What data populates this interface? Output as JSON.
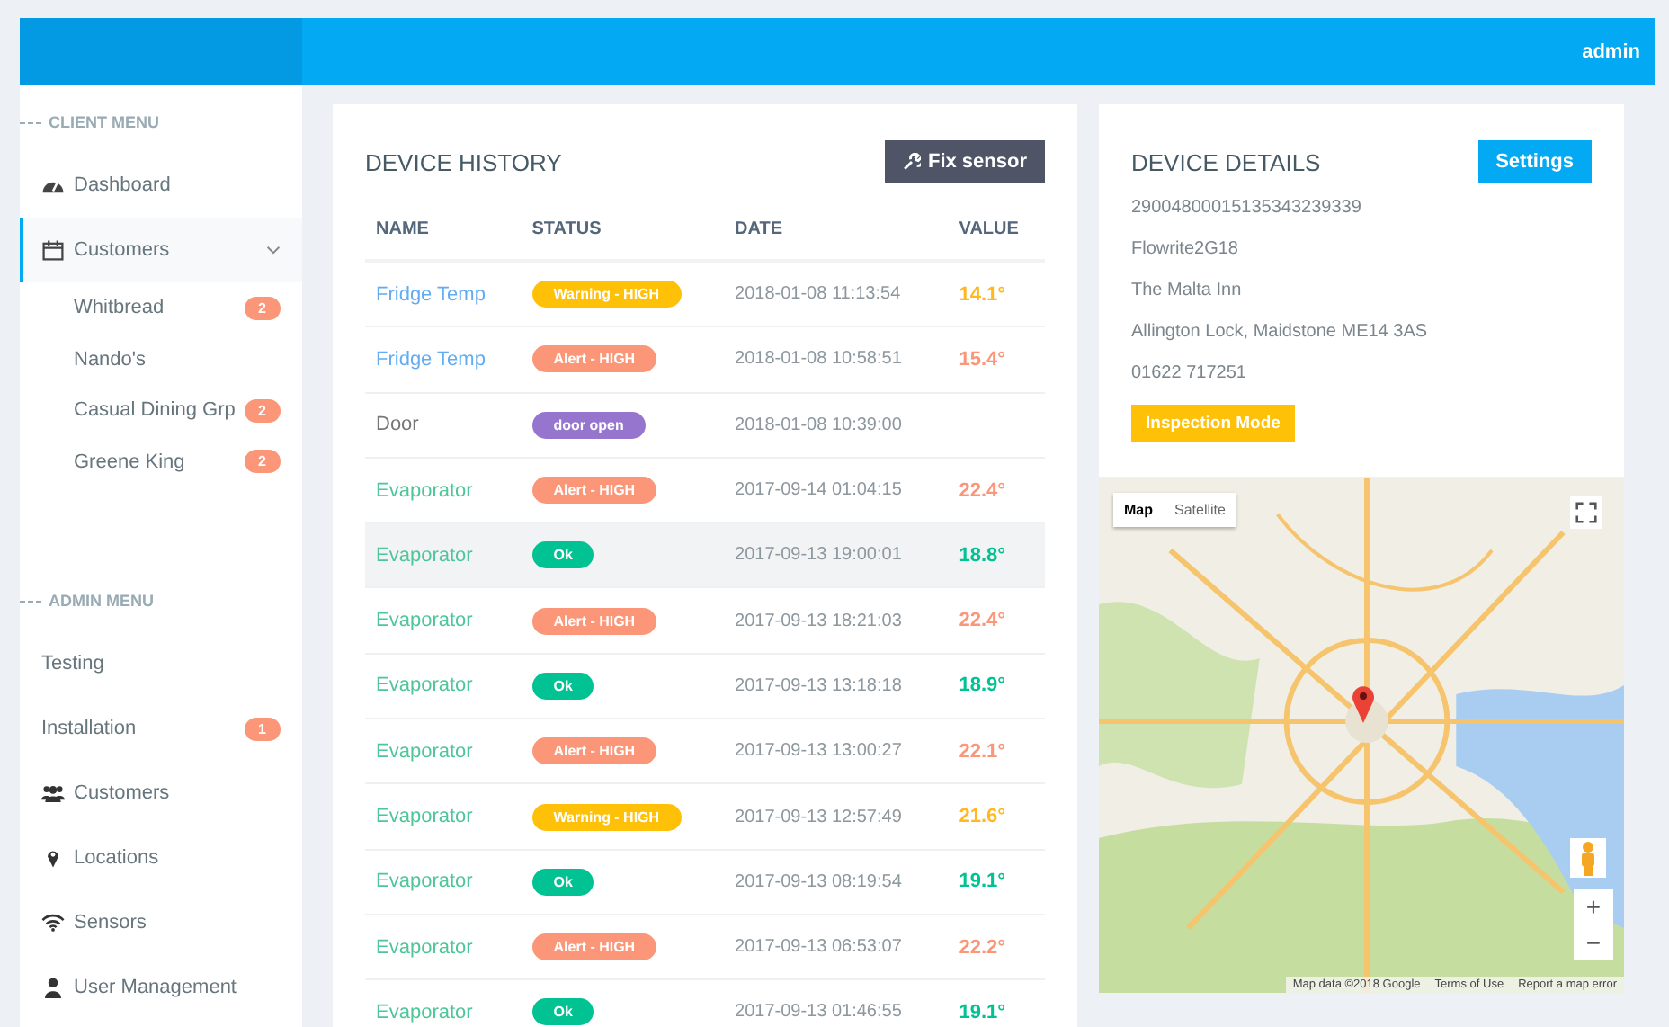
{
  "topbar": {
    "user": "admin"
  },
  "sidebar": {
    "sections": [
      {
        "title": "CLIENT MENU",
        "items": [
          {
            "label": "Dashboard",
            "kind": "gauge",
            "selected": false
          },
          {
            "label": "Customers",
            "kind": "calendar",
            "selected": true,
            "expanded": true,
            "children": [
              {
                "label": "Whitbread",
                "badge": "2"
              },
              {
                "label": "Nando's"
              },
              {
                "label": "Casual Dining Grp",
                "badge": "2"
              },
              {
                "label": "Greene King",
                "badge": "2"
              }
            ]
          }
        ]
      },
      {
        "title": "ADMIN MENU",
        "items": [
          {
            "label": "Testing",
            "selected": false
          },
          {
            "label": "Installation",
            "badge": "1",
            "selected": false
          },
          {
            "label": "Customers",
            "kind": "users",
            "selected": false
          },
          {
            "label": "Locations",
            "kind": "pin",
            "selected": false
          },
          {
            "label": "Sensors",
            "kind": "wifi",
            "selected": false
          },
          {
            "label": "User Management",
            "kind": "user",
            "selected": false
          }
        ]
      }
    ]
  },
  "history": {
    "title": "DEVICE HISTORY",
    "button": "Fix sensor",
    "columns": [
      "NAME",
      "STATUS",
      "DATE",
      "VALUE"
    ],
    "rows": [
      {
        "name": "Fridge Temp",
        "color": "#63acf2",
        "status": "Warning - HIGH",
        "kind": "warning",
        "date": "2018-01-08 11:13:54",
        "value": "14.1°",
        "selected": false
      },
      {
        "name": "Fridge Temp",
        "color": "#63acf2",
        "status": "Alert - HIGH",
        "kind": "alert",
        "date": "2018-01-08 10:58:51",
        "value": "15.4°",
        "selected": false
      },
      {
        "name": "Door",
        "color": "#777777",
        "status": "door open",
        "kind": "door",
        "date": "2018-01-08 10:39:00",
        "selected": false
      },
      {
        "name": "Evaporator",
        "color": "#4fc69a",
        "status": "Alert - HIGH",
        "kind": "alert",
        "date": "2017-09-14 01:04:15",
        "value": "22.4°",
        "selected": false
      },
      {
        "name": "Evaporator",
        "color": "#4fc69a",
        "status": "Ok",
        "kind": "ok",
        "date": "2017-09-13 19:00:01",
        "value": "18.8°",
        "selected": true
      },
      {
        "name": "Evaporator",
        "color": "#4fc69a",
        "status": "Alert - HIGH",
        "kind": "alert",
        "date": "2017-09-13 18:21:03",
        "value": "22.4°",
        "selected": false
      },
      {
        "name": "Evaporator",
        "color": "#4fc69a",
        "status": "Ok",
        "kind": "ok",
        "date": "2017-09-13 13:18:18",
        "value": "18.9°",
        "selected": false
      },
      {
        "name": "Evaporator",
        "color": "#4fc69a",
        "status": "Alert - HIGH",
        "kind": "alert",
        "date": "2017-09-13 13:00:27",
        "value": "22.1°",
        "selected": false
      },
      {
        "name": "Evaporator",
        "color": "#4fc69a",
        "status": "Warning - HIGH",
        "kind": "warning",
        "date": "2017-09-13 12:57:49",
        "value": "21.6°",
        "selected": false
      },
      {
        "name": "Evaporator",
        "color": "#4fc69a",
        "status": "Ok",
        "kind": "ok",
        "date": "2017-09-13 08:19:54",
        "value": "19.1°",
        "selected": false
      },
      {
        "name": "Evaporator",
        "color": "#4fc69a",
        "status": "Alert - HIGH",
        "kind": "alert",
        "date": "2017-09-13 06:53:07",
        "value": "22.2°",
        "selected": false
      },
      {
        "name": "Evaporator",
        "color": "#4fc69a",
        "status": "Ok",
        "kind": "ok",
        "date": "2017-09-13 01:46:55",
        "value": "19.1°",
        "selected": false
      }
    ]
  },
  "details": {
    "title": "DEVICE DETAILS",
    "button": "Settings",
    "lines": [
      "29004800015135343239339",
      "Flowrite2G18",
      "The Malta Inn",
      "Allington Lock, Maidstone ME14 3AS",
      "01622 717251"
    ],
    "mode_button": "Inspection Mode"
  },
  "map": {
    "kind": "picture",
    "types": [
      {
        "label": "Map",
        "selected": true
      },
      {
        "label": "Satellite",
        "selected": false
      }
    ],
    "zoom_in": "+",
    "zoom_out": "−",
    "footer": [
      "Map data ©2018 Google",
      "Terms of Use",
      "Report a map error"
    ]
  }
}
